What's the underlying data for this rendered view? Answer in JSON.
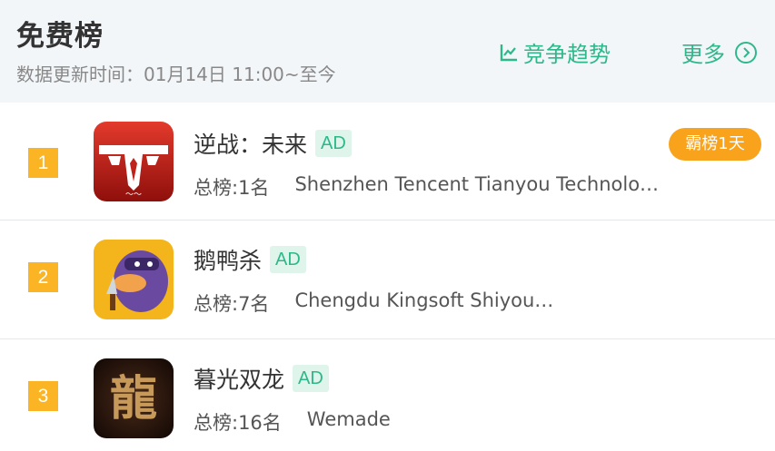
{
  "header": {
    "title": "免费榜",
    "subtitle": "数据更新时间：01月14日 11:00~至今",
    "trend_label": "竞争趋势",
    "more_label": "更多"
  },
  "colors": {
    "accent": "#2eb88a",
    "rank_badge": "#fbb424",
    "streak_badge": "#f9a21b",
    "ad_bg": "#dff5ec"
  },
  "apps": [
    {
      "rank": "1",
      "name": "逆战：未来",
      "ad": "AD",
      "overall": "总榜:1名",
      "developer": "Shenzhen Tencent Tianyou Technolo…",
      "badge": "霸榜1天"
    },
    {
      "rank": "2",
      "name": "鹅鸭杀",
      "ad": "AD",
      "overall": "总榜:7名",
      "developer": "Chengdu Kingsoft Shiyou…"
    },
    {
      "rank": "3",
      "name": "暮光双龙",
      "ad": "AD",
      "overall": "总榜:16名",
      "developer": "Wemade"
    }
  ]
}
